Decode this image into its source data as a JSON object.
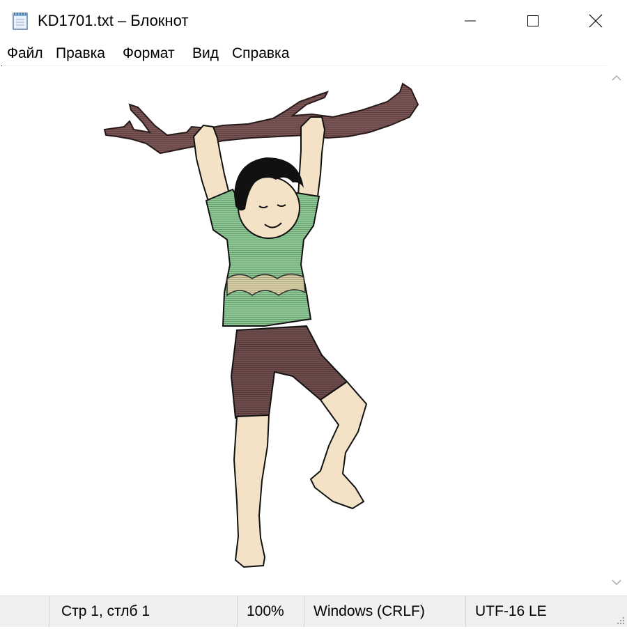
{
  "window": {
    "title": "KD1701.txt – Блокнот",
    "icons": {
      "app": "notepad-icon",
      "minimize": "minimize-icon",
      "maximize": "maximize-icon",
      "close": "close-icon"
    }
  },
  "menu": {
    "items": [
      {
        "label": "Файл"
      },
      {
        "label": "Правка"
      },
      {
        "label": "Формат"
      },
      {
        "label": "Вид"
      },
      {
        "label": "Справка"
      }
    ]
  },
  "document": {
    "content_description": "ascii-art-boy-hanging-from-branch",
    "colors": {
      "branch": "#7a5454",
      "shirt": "#8cc894",
      "shorts": "#6e4c4c",
      "skin": "#f3e2c6",
      "hair": "#111111",
      "stripe": "#d8d0a4"
    }
  },
  "scrollbar": {
    "up_icon": "chevron-up-icon",
    "down_icon": "chevron-down-icon"
  },
  "status": {
    "position": "Стр 1, стлб 1",
    "zoom": "100%",
    "line_endings": "Windows (CRLF)",
    "encoding": "UTF-16 LE"
  }
}
